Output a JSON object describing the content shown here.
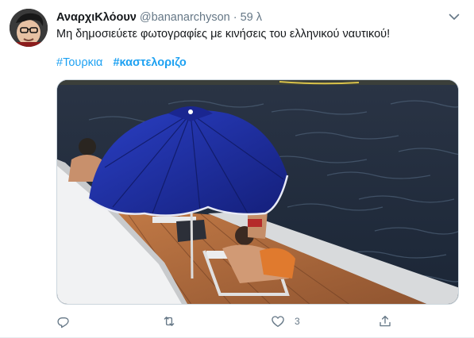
{
  "tweet": {
    "author": {
      "display_name": "ΑναρχιΚλόουν",
      "handle": "@bananarchyson"
    },
    "separator": "·",
    "time": "59 λ",
    "text": "Μη δημοσιεύετε φωτογραφίες με κινήσεις του ελληνικού ναυτικού!",
    "hashtags": [
      {
        "text": "#Τουρκια",
        "bold": false
      },
      {
        "text": "#καστελοριζο",
        "bold": true
      }
    ],
    "actions": {
      "reply": {
        "icon": "reply-icon"
      },
      "retweet": {
        "icon": "retweet-icon"
      },
      "like": {
        "icon": "heart-icon",
        "count": "3"
      },
      "share": {
        "icon": "share-icon"
      }
    }
  },
  "colors": {
    "link": "#1da1f2",
    "secondary_text": "#657786",
    "umbrella": "#1e2fa0",
    "sea": "#223044",
    "deck": "#b06a3c"
  }
}
